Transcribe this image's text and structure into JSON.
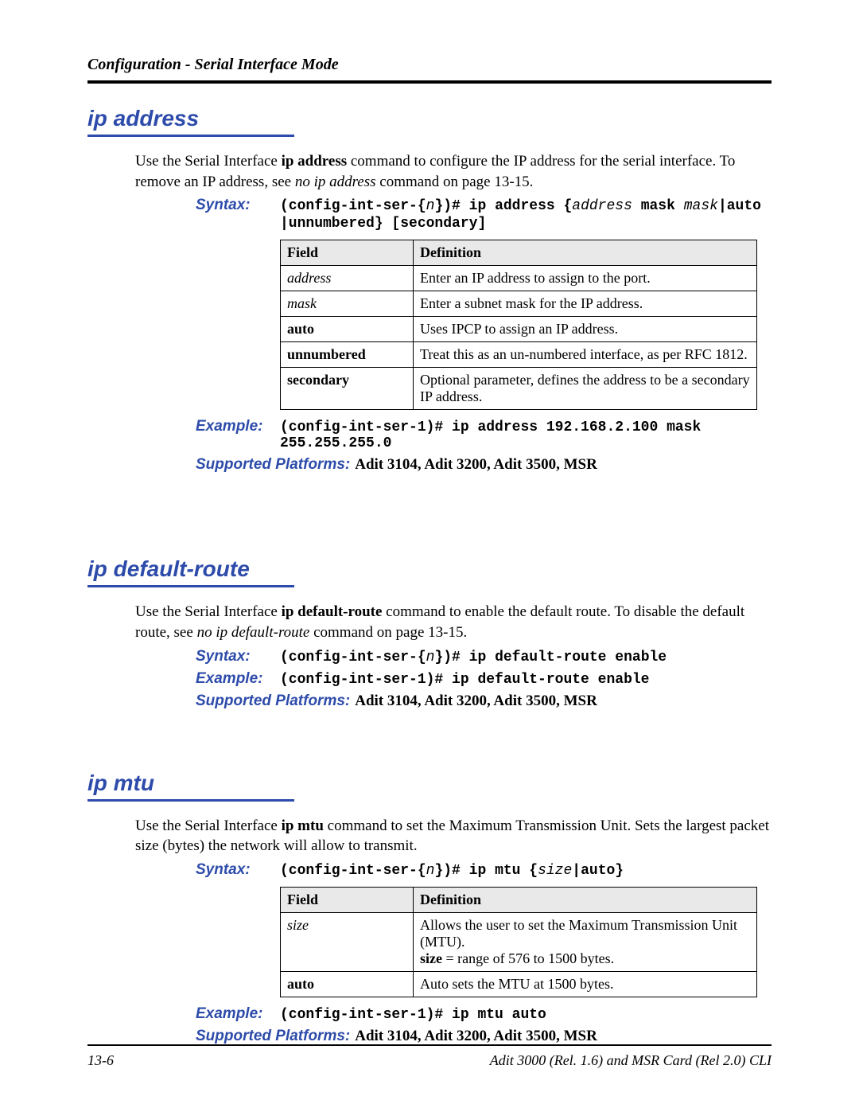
{
  "running_head": "Configuration - Serial Interface Mode",
  "sections": {
    "ip_address": {
      "title": "ip address",
      "intro_pre": "Use the Serial Interface ",
      "intro_cmd_bold": "ip address",
      "intro_mid": " command to configure the IP address for the serial interface.  To remove an IP address, see ",
      "intro_link_italic": "no ip address",
      "intro_post": " command on page 13-15.",
      "syntax_label": "Syntax:",
      "syntax_l1_a": "(config-int-ser-{",
      "syntax_l1_n": "n",
      "syntax_l1_b": "})# ip address {",
      "syntax_l1_addr": "address",
      "syntax_l1_c": " mask ",
      "syntax_l1_mask": "mask",
      "syntax_l1_d": "|auto",
      "syntax_l2": "|unnumbered} [secondary]",
      "table": {
        "headers": {
          "field": "Field",
          "def": "Definition"
        },
        "rows": [
          {
            "field": "address",
            "italic": true,
            "bold": false,
            "def": "Enter an IP address to assign to the port."
          },
          {
            "field": "mask",
            "italic": true,
            "bold": false,
            "def": "Enter a subnet mask for the IP address."
          },
          {
            "field": "auto",
            "italic": false,
            "bold": true,
            "def": "Uses IPCP to assign an IP address."
          },
          {
            "field": "unnumbered",
            "italic": false,
            "bold": true,
            "def": "Treat this as an un-numbered interface, as per RFC 1812."
          },
          {
            "field": "secondary",
            "italic": false,
            "bold": true,
            "def": "Optional parameter, defines the address to be a secondary IP address."
          }
        ]
      },
      "example_label": "Example:",
      "example_cmd": "(config-int-ser-1)# ip address 192.168.2.100 mask 255.255.255.0",
      "platforms_label": "Supported Platforms:",
      "platforms": " Adit 3104, Adit 3200, Adit 3500, MSR"
    },
    "ip_default_route": {
      "title": "ip default-route",
      "intro_pre": "Use the Serial Interface ",
      "intro_cmd_bold": "ip default-route",
      "intro_mid": " command to enable the default route. To disable the default route, see ",
      "intro_link_italic": "no ip default-route",
      "intro_post": " command on page 13-15.",
      "syntax_label": "Syntax:",
      "syntax_a": "(config-int-ser-{",
      "syntax_n": "n",
      "syntax_b": "})# ip default-route enable",
      "example_label": "Example:",
      "example_cmd": "(config-int-ser-1)# ip default-route enable",
      "platforms_label": "Supported Platforms:",
      "platforms": " Adit 3104, Adit 3200, Adit 3500, MSR"
    },
    "ip_mtu": {
      "title": "ip mtu",
      "intro_pre": "Use the Serial Interface ",
      "intro_cmd_bold": "ip mtu",
      "intro_post": " command to set the Maximum Transmission Unit. Sets the largest packet size (bytes) the network will allow to transmit.",
      "syntax_label": "Syntax:",
      "syntax_a": "(config-int-ser-{",
      "syntax_n": "n",
      "syntax_b": "})# ip mtu {",
      "syntax_size": "size",
      "syntax_c": "|auto}",
      "table": {
        "headers": {
          "field": "Field",
          "def": "Definition"
        },
        "rows": [
          {
            "field": "size",
            "italic": true,
            "bold": false,
            "def_pre": "Allows the user to set the Maximum Transmission Unit (MTU).",
            "def_size_bold": "size",
            "def_post": " = range of 576 to 1500 bytes."
          },
          {
            "field": "auto",
            "italic": false,
            "bold": true,
            "def_pre": "Auto sets the MTU at 1500 bytes.",
            "def_size_bold": "",
            "def_post": ""
          }
        ]
      },
      "example_label": "Example:",
      "example_cmd": "(config-int-ser-1)# ip mtu auto",
      "platforms_label": "Supported Platforms:",
      "platforms": " Adit 3104, Adit 3200, Adit 3500, MSR"
    }
  },
  "footer": {
    "page_number": "13-6",
    "doc_title": "Adit 3000 (Rel. 1.6) and MSR Card (Rel 2.0) CLI"
  }
}
